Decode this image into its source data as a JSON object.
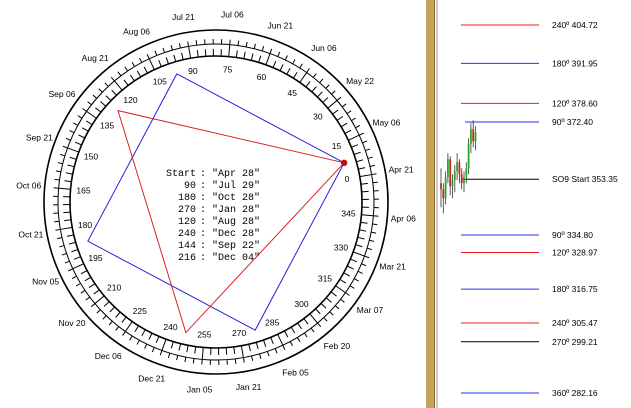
{
  "colors": {
    "square": "#2222dd",
    "triangle": "#dd2222",
    "divider": "#c6a55a",
    "marker": "#bb1111"
  },
  "wheel": {
    "degree_labels": [
      "0",
      "15",
      "30",
      "45",
      "60",
      "75",
      "90",
      "105",
      "120",
      "135",
      "150",
      "165",
      "180",
      "195",
      "210",
      "225",
      "240",
      "255",
      "270",
      "285",
      "300",
      "315",
      "330",
      "345"
    ],
    "date_labels": [
      "Apr 21",
      "May 06",
      "May 22",
      "Jun 06",
      "Jun 21",
      "Jul 06",
      "Jul 21",
      "Aug 06",
      "Aug 21",
      "Sep 06",
      "Sep 21",
      "Oct 06",
      "Oct 21",
      "Nov 05",
      "Nov 20",
      "Dec 06",
      "Dec 21",
      "Jan 05",
      "Jan 21",
      "Feb 05",
      "Feb 20",
      "Mar 07",
      "Mar 21",
      "Apr 06"
    ],
    "info": [
      {
        "label": "Start",
        "date": "\"Apr 28\""
      },
      {
        "label": "90",
        "date": "\"Jul 29\""
      },
      {
        "label": "180",
        "date": "\"Oct 28\""
      },
      {
        "label": "270",
        "date": "\"Jan 28\""
      },
      {
        "label": "120",
        "date": "\"Aug 28\""
      },
      {
        "label": "240",
        "date": "\"Dec 28\""
      },
      {
        "label": "144",
        "date": "\"Sep 22\""
      },
      {
        "label": "216",
        "date": "\"Dec 04\""
      }
    ],
    "start_degree": 7
  },
  "levels": [
    {
      "label": "240º 404.72",
      "price": 404.72,
      "color": "red"
    },
    {
      "label": "180º 391.95",
      "price": 391.95,
      "color": "blue"
    },
    {
      "label": "120º 378.60",
      "price": 378.6,
      "color": "red"
    },
    {
      "label": "90º 372.40",
      "price": 372.4,
      "color": "blue"
    },
    {
      "label": "SO9 Start 353.35",
      "price": 353.35,
      "color": "black"
    },
    {
      "label": "90º 334.80",
      "price": 334.8,
      "color": "blue"
    },
    {
      "label": "120º 328.97",
      "price": 328.97,
      "color": "red"
    },
    {
      "label": "180º 316.75",
      "price": 316.75,
      "color": "blue"
    },
    {
      "label": "240º 305.47",
      "price": 305.47,
      "color": "red"
    },
    {
      "label": "270º 299.21",
      "price": 299.21,
      "color": "black"
    },
    {
      "label": "360º 282.16",
      "price": 282.16,
      "color": "blue"
    }
  ],
  "candles": [
    {
      "o": 352,
      "h": 357,
      "l": 344,
      "c": 350
    },
    {
      "o": 350,
      "h": 352,
      "l": 342,
      "c": 347
    },
    {
      "o": 347,
      "h": 356,
      "l": 345,
      "c": 354
    },
    {
      "o": 354,
      "h": 362,
      "l": 352,
      "c": 360
    },
    {
      "o": 360,
      "h": 361,
      "l": 348,
      "c": 351
    },
    {
      "o": 351,
      "h": 355,
      "l": 347,
      "c": 353
    },
    {
      "o": 353,
      "h": 358,
      "l": 349,
      "c": 356
    },
    {
      "o": 356,
      "h": 362,
      "l": 353,
      "c": 359
    },
    {
      "o": 359,
      "h": 360,
      "l": 352,
      "c": 355
    },
    {
      "o": 355,
      "h": 357,
      "l": 350,
      "c": 352
    },
    {
      "o": 352,
      "h": 356,
      "l": 349,
      "c": 354
    },
    {
      "o": 354,
      "h": 359,
      "l": 352,
      "c": 357
    },
    {
      "o": 357,
      "h": 367,
      "l": 355,
      "c": 365
    },
    {
      "o": 365,
      "h": 372,
      "l": 362,
      "c": 370
    },
    {
      "o": 370,
      "h": 373,
      "l": 364,
      "c": 366
    },
    {
      "o": 366,
      "h": 371,
      "l": 363,
      "c": 369
    }
  ]
}
